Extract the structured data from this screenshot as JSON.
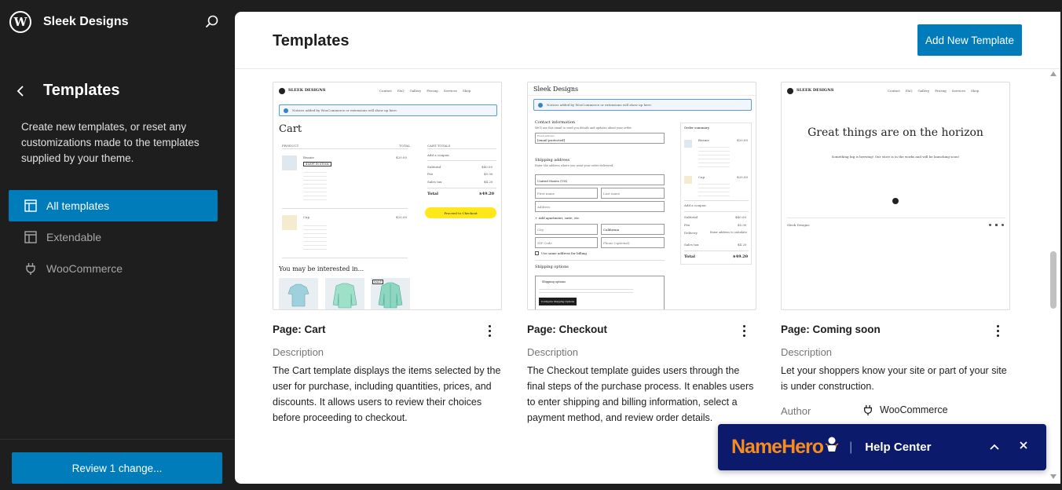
{
  "site": {
    "name": "Sleek Designs",
    "logo_letter": "W"
  },
  "sidebar": {
    "title": "Templates",
    "description": "Create new templates, or reset any customizations made to the templates supplied by your theme.",
    "items": [
      {
        "label": "All templates",
        "active": true
      },
      {
        "label": "Extendable",
        "active": false
      },
      {
        "label": "WooCommerce",
        "active": false
      }
    ],
    "review_button": "Review 1 change..."
  },
  "main": {
    "title": "Templates",
    "add_button": "Add New Template",
    "description_label": "Description",
    "author_label": "Author"
  },
  "cards": [
    {
      "title": "Page: Cart",
      "description": "The Cart template displays the items selected by the user for purchase, including quantities, prices, and discounts. It allows users to review their choices before proceeding to checkout.",
      "preview": {
        "brand": "SLEEK DESIGNS",
        "nav": [
          "Contact",
          "FAQ",
          "Gallery",
          "Pricing",
          "Services",
          "Shop"
        ],
        "heading": "Cart",
        "notice": "Notices added by WooCommerce or extensions will show up here.",
        "product_col": "PRODUCT",
        "total_col": "TOTAL",
        "cart_totals": "CART TOTALS",
        "add_coupon": "Add a coupon",
        "items": [
          {
            "name": "Beanie",
            "price": "$20.00",
            "badge": "4 LEFT IN STOCK"
          },
          {
            "name": "Cap",
            "price": "$20.00",
            "badge": ""
          }
        ],
        "totals": [
          {
            "label": "Subtotal",
            "value": "$40.00"
          },
          {
            "label": "Fee",
            "value": "$5.00"
          },
          {
            "label": "Sales tax",
            "value": "$4.20"
          }
        ],
        "total_label": "Total",
        "total_value": "$49.20",
        "checkout_button": "Proceed to Checkout",
        "interested": "You may be interested in...",
        "sale_badge": "SALE"
      }
    },
    {
      "title": "Page: Checkout",
      "description": "The Checkout template guides users through the final steps of the purchase process. It enables users to enter shipping and billing information, select a payment method, and review order details.",
      "preview": {
        "brand": "Sleek Designs",
        "notice": "Notices added by WooCommerce or extensions will show up here.",
        "contact": "Contact information",
        "contact_sub": "We'll use this email to send you details and updates about your order.",
        "email_label": "Email address",
        "email_value": "[email protected]",
        "shipping_address": "Shipping address",
        "shipping_sub": "Enter the address where you want your order delivered.",
        "country": "United States (US)",
        "first_name": "First name",
        "last_name": "Last name",
        "address": "Address",
        "add_apartment": "+ Add apartment, suite, etc.",
        "city": "City",
        "state": "California",
        "zip": "ZIP Code",
        "phone": "Phone (optional)",
        "same_billing": "Use same address for billing",
        "shipping_options": "Shipping options",
        "shipping_options_text": "Shipping options",
        "config_button": "Configure Shipping Options",
        "order_summary": "Order summary",
        "items": [
          {
            "name": "Beanie",
            "price": "$20.00"
          },
          {
            "name": "Cap",
            "price": "$20.00"
          }
        ],
        "add_coupon": "Add a coupon",
        "totals": [
          {
            "label": "Subtotal",
            "value": "$40.00"
          },
          {
            "label": "Fee",
            "value": "$5.00"
          },
          {
            "label": "Delivery",
            "value": "Enter address to calculate"
          },
          {
            "label": "Sales tax",
            "value": "$4.20"
          }
        ],
        "total_label": "Total",
        "total_value": "$49.20"
      }
    },
    {
      "title": "Page: Coming soon",
      "description": "Let your shoppers know your site or part of your site is under construction.",
      "author": "WooCommerce",
      "preview": {
        "brand": "SLEEK DESIGNS",
        "nav": [
          "Contact",
          "FAQ",
          "Gallery",
          "Pricing",
          "Services",
          "Shop"
        ],
        "heading": "Great things are on the horizon",
        "sub": "Something big is brewing! Our store is in the works and will be launching soon!",
        "footer": "Sleek Designs"
      }
    }
  ],
  "help": {
    "logo_name": "NameHero",
    "title": "Help Center",
    "separator": "|"
  },
  "colors": {
    "accent": "#007cba",
    "sidebar_bg": "#1e1e1e",
    "help_bg": "#0b1a6b",
    "brand_orange": "#f68b1f"
  }
}
